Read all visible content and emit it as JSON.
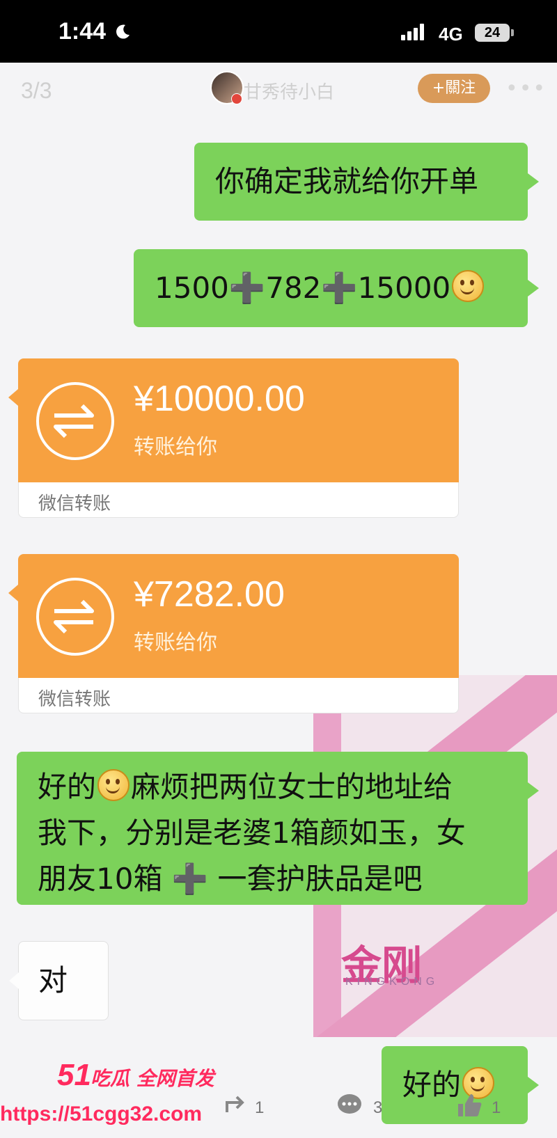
{
  "status_bar": {
    "time": "1:44",
    "network": "4G",
    "battery": "24"
  },
  "header": {
    "counter": "3/3",
    "username": "甘秀待小白",
    "follow_label": "+關注",
    "more": "•••"
  },
  "messages": {
    "m1": "你确定我就给你开单",
    "m2_a": "1500",
    "m2_b": "782",
    "m2_c": "15000",
    "plus": "➕",
    "t1": {
      "amount": "¥10000.00",
      "caption": "转账给你",
      "source": "微信转账"
    },
    "t2": {
      "amount": "¥7282.00",
      "caption": "转账给你",
      "source": "微信转账"
    },
    "m5_a": "好的",
    "m5_b": "麻烦把两位女士的地址给",
    "m5_c": "我下，分别是老婆1箱颜如玉，女",
    "m5_d": "朋友10箱",
    "m5_e": "一套护肤品是吧",
    "m6": "对",
    "m7": "好的"
  },
  "background_ad": {
    "brand": "金刚",
    "brand_en": "KINGKONG"
  },
  "actions": {
    "share_count": "1",
    "comment_count": "3",
    "like_count": "1"
  },
  "watermark": {
    "num": "51",
    "cn": "吃瓜 全网首发",
    "url": "https://51cgg32.com"
  },
  "colors": {
    "green_bubble": "#7cd25a",
    "transfer_orange": "#f7a140",
    "follow_button": "#d99a59",
    "watermark": "#ff2a5e"
  }
}
